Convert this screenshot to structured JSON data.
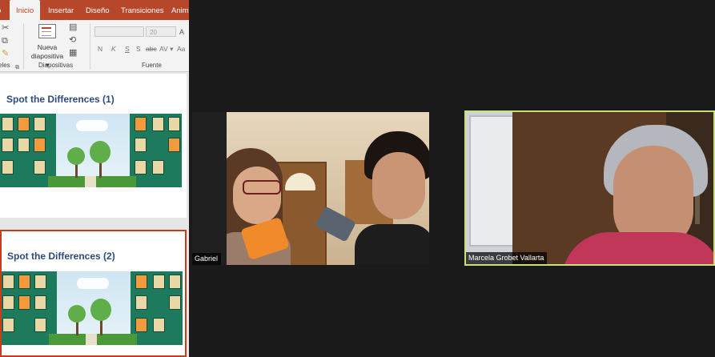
{
  "ppt": {
    "tabs": [
      "o",
      "Inicio",
      "Insertar",
      "Diseño",
      "Transiciones",
      "Anim"
    ],
    "groups": {
      "clipboard": "eles",
      "slides": "Diapositivas",
      "font": "Fuente"
    },
    "new_slide": {
      "line1": "Nueva",
      "line2": "diapositiva ▾"
    },
    "font_size": "20",
    "format_buttons": [
      "N",
      "K",
      "S",
      "S",
      "abc",
      "AV ▾",
      "Aa"
    ],
    "slides": [
      {
        "title": "Spot the Differences (1)",
        "selected": false
      },
      {
        "title": "Spot the Differences (2)",
        "selected": true
      }
    ]
  },
  "zoom": {
    "participants": [
      {
        "name": "Gabriel",
        "active_speaker": false
      },
      {
        "name": "Marcela Grobet Vallarta",
        "active_speaker": true
      }
    ],
    "active_speaker_border_color": "#c6e27a"
  },
  "icons": [
    "cut-icon",
    "copy-icon",
    "format-painter-icon",
    "new-slide-icon",
    "layout-icon",
    "reset-icon",
    "section-icon",
    "dialog-launcher-icon"
  ]
}
